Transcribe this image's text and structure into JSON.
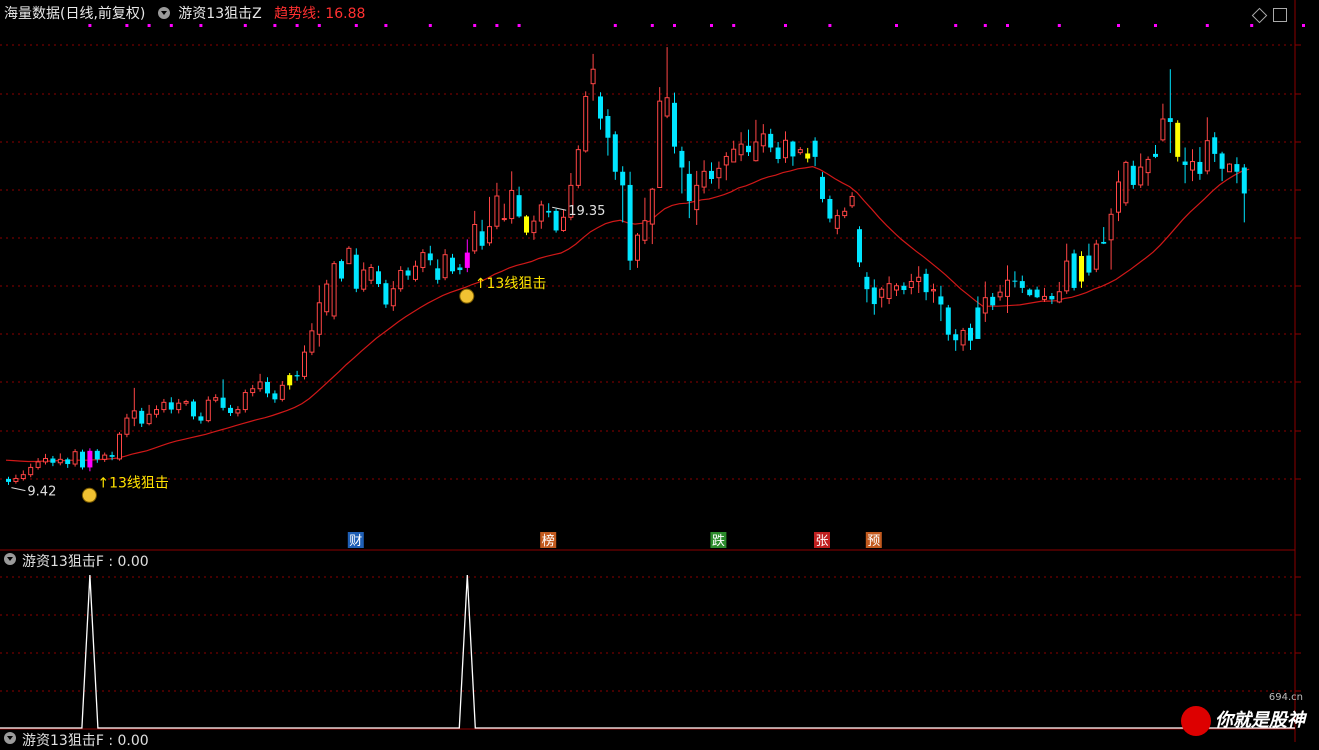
{
  "header": {
    "source": "海量数据(日线,前复权)",
    "indicator": "游资13狙击Z",
    "trend_label": "趋势线: 16.88"
  },
  "subpanel1": {
    "title": "游资13狙击F : 0.00"
  },
  "subpanel2": {
    "title": "游资13狙击F : 0.00"
  },
  "watermark": {
    "brand": "你就是股神",
    "url": "694.cn"
  },
  "colors": {
    "up": "#ff4545",
    "down": "#00e5ff",
    "signal_magenta": "#ff00ff",
    "signal_yellow": "#ffff00",
    "ma": "#d01818",
    "grid": "#8b0000",
    "label_yellow": "#ffe400",
    "spike": "#ffffff"
  },
  "chart_data": [
    {
      "type": "candlestick",
      "title": "游资13狙击Z",
      "candles": [
        [
          9.56,
          9.49,
          9.61,
          9.42
        ],
        [
          9.5,
          9.57,
          9.66,
          9.45
        ],
        [
          9.57,
          9.66,
          9.76,
          9.52
        ],
        [
          9.66,
          9.83,
          9.92,
          9.6
        ],
        [
          9.83,
          9.96,
          10.05,
          9.78
        ],
        [
          9.96,
          10.04,
          10.15,
          9.9
        ],
        [
          10.04,
          9.94,
          10.1,
          9.86
        ],
        [
          9.94,
          10.02,
          10.16,
          9.88
        ],
        [
          10.02,
          9.91,
          10.06,
          9.82
        ],
        [
          9.91,
          10.2,
          10.26,
          9.85
        ],
        [
          10.2,
          9.83,
          10.25,
          9.78
        ],
        [
          9.83,
          10.22,
          10.28,
          9.74
        ],
        [
          10.22,
          10.02,
          10.26,
          9.94
        ],
        [
          10.02,
          10.12,
          10.18,
          9.96
        ],
        [
          10.12,
          10.08,
          10.2,
          10.0
        ],
        [
          10.03,
          10.61,
          10.66,
          9.99
        ],
        [
          10.61,
          10.99,
          11.09,
          10.54
        ],
        [
          10.99,
          11.16,
          11.7,
          10.8
        ],
        [
          11.16,
          10.86,
          11.23,
          10.78
        ],
        [
          10.86,
          11.08,
          11.3,
          10.82
        ],
        [
          11.08,
          11.19,
          11.29,
          11.0
        ],
        [
          11.19,
          11.36,
          11.44,
          11.12
        ],
        [
          11.36,
          11.19,
          11.48,
          11.1
        ],
        [
          11.19,
          11.34,
          11.44,
          11.1
        ],
        [
          11.34,
          11.38,
          11.42,
          11.28
        ],
        [
          11.38,
          11.03,
          11.43,
          10.96
        ],
        [
          11.03,
          10.93,
          11.12,
          10.86
        ],
        [
          10.93,
          11.41,
          11.5,
          10.89
        ],
        [
          11.41,
          11.47,
          11.55,
          11.36
        ],
        [
          11.47,
          11.23,
          11.9,
          11.17
        ],
        [
          11.23,
          11.11,
          11.3,
          11.04
        ],
        [
          11.11,
          11.19,
          11.27,
          11.03
        ],
        [
          11.19,
          11.59,
          11.66,
          11.12
        ],
        [
          11.59,
          11.68,
          11.77,
          11.5
        ],
        [
          11.68,
          11.84,
          12.03,
          11.61
        ],
        [
          11.84,
          11.57,
          11.95,
          11.48
        ],
        [
          11.57,
          11.43,
          11.64,
          11.35
        ],
        [
          11.43,
          11.76,
          11.86,
          11.38
        ],
        [
          11.76,
          12.0,
          12.05,
          11.66
        ],
        [
          12.0,
          11.97,
          12.1,
          11.87
        ],
        [
          11.97,
          12.54,
          12.7,
          11.9
        ],
        [
          12.54,
          13.04,
          13.22,
          12.47
        ],
        [
          12.96,
          13.7,
          14.11,
          12.67
        ],
        [
          13.49,
          14.14,
          14.24,
          13.4
        ],
        [
          13.39,
          14.62,
          14.68,
          13.31
        ],
        [
          14.68,
          14.27,
          14.72,
          14.2
        ],
        [
          14.62,
          14.98,
          15.03,
          14.62
        ],
        [
          14.83,
          14.03,
          14.98,
          13.95
        ],
        [
          14.02,
          14.47,
          14.65,
          13.96
        ],
        [
          14.23,
          14.53,
          14.61,
          14.14
        ],
        [
          14.44,
          14.14,
          14.57,
          14.07
        ],
        [
          14.16,
          13.66,
          14.24,
          13.58
        ],
        [
          13.63,
          14.03,
          14.21,
          13.51
        ],
        [
          14.03,
          14.46,
          14.56,
          13.96
        ],
        [
          14.46,
          14.34,
          14.53,
          14.24
        ],
        [
          14.25,
          14.56,
          14.69,
          14.2
        ],
        [
          14.53,
          14.88,
          14.96,
          14.42
        ],
        [
          14.86,
          14.7,
          15.04,
          14.58
        ],
        [
          14.51,
          14.24,
          14.72,
          14.15
        ],
        [
          14.29,
          14.83,
          14.96,
          14.23
        ],
        [
          14.76,
          14.44,
          14.85,
          14.38
        ],
        [
          14.53,
          14.47,
          14.61,
          14.37
        ],
        [
          14.52,
          14.88,
          15.19,
          14.42
        ],
        [
          14.92,
          15.54,
          15.86,
          14.85
        ],
        [
          15.38,
          15.04,
          15.65,
          14.95
        ],
        [
          15.11,
          15.49,
          16.19,
          15.04
        ],
        [
          15.5,
          16.21,
          16.52,
          15.43
        ],
        [
          15.67,
          15.68,
          16.03,
          15.61
        ],
        [
          15.68,
          16.34,
          16.79,
          15.56
        ],
        [
          16.23,
          15.73,
          16.43,
          15.7
        ],
        [
          15.73,
          15.35,
          15.76,
          15.29
        ],
        [
          15.35,
          15.62,
          15.75,
          15.18
        ],
        [
          15.62,
          16.0,
          16.1,
          15.44
        ],
        [
          15.86,
          15.82,
          16.04,
          15.71
        ],
        [
          15.86,
          15.4,
          15.91,
          15.35
        ],
        [
          15.4,
          15.71,
          15.88,
          15.37
        ],
        [
          15.71,
          16.46,
          16.75,
          15.64
        ],
        [
          16.46,
          17.3,
          17.4,
          16.39
        ],
        [
          17.27,
          18.55,
          18.67,
          17.23
        ],
        [
          18.85,
          19.19,
          19.55,
          18.45
        ],
        [
          18.55,
          18.03,
          18.65,
          17.77
        ],
        [
          18.09,
          17.58,
          18.25,
          17.16
        ],
        [
          17.66,
          16.78,
          17.73,
          16.59
        ],
        [
          16.78,
          16.46,
          16.91,
          15.59
        ],
        [
          16.47,
          14.69,
          16.78,
          14.47
        ],
        [
          14.7,
          15.29,
          15.34,
          14.52
        ],
        [
          15.17,
          15.63,
          16.17,
          15.08
        ],
        [
          15.55,
          16.37,
          16.4,
          15.08
        ],
        [
          16.41,
          18.44,
          18.77,
          16.44
        ],
        [
          18.09,
          18.52,
          19.71,
          18.04
        ],
        [
          18.4,
          17.37,
          18.64,
          17.21
        ],
        [
          17.27,
          16.88,
          17.37,
          16.27
        ],
        [
          16.73,
          16.09,
          17.03,
          15.69
        ],
        [
          15.89,
          16.46,
          16.8,
          15.53
        ],
        [
          16.42,
          16.79,
          17.05,
          16.27
        ],
        [
          16.8,
          16.61,
          17.0,
          16.5
        ],
        [
          16.64,
          16.86,
          17.02,
          16.38
        ],
        [
          16.94,
          17.14,
          17.24,
          16.58
        ],
        [
          17.01,
          17.31,
          17.51,
          17.15
        ],
        [
          17.18,
          17.43,
          17.71,
          17.03
        ],
        [
          17.39,
          17.24,
          17.77,
          17.15
        ],
        [
          17.04,
          17.48,
          18.0,
          17.02
        ],
        [
          17.39,
          17.67,
          17.9,
          17.23
        ],
        [
          17.67,
          17.35,
          17.79,
          17.24
        ],
        [
          17.35,
          17.08,
          17.48,
          16.98
        ],
        [
          17.11,
          17.52,
          17.73,
          16.99
        ],
        [
          17.49,
          17.14,
          17.51,
          16.92
        ],
        [
          17.23,
          17.3,
          17.36,
          17.18
        ],
        [
          17.21,
          17.09,
          17.34,
          17.0
        ],
        [
          17.51,
          17.13,
          17.59,
          16.91
        ],
        [
          16.66,
          16.14,
          16.77,
          16.06
        ],
        [
          16.14,
          15.68,
          16.22,
          15.59
        ],
        [
          15.45,
          15.75,
          15.89,
          15.31
        ],
        [
          15.75,
          15.85,
          15.94,
          15.69
        ],
        [
          15.98,
          16.2,
          16.3,
          15.93
        ],
        [
          15.43,
          14.65,
          15.5,
          14.54
        ],
        [
          14.31,
          14.02,
          14.42,
          13.71
        ],
        [
          14.06,
          13.67,
          14.25,
          13.42
        ],
        [
          13.83,
          14.02,
          14.07,
          13.59
        ],
        [
          13.8,
          14.15,
          14.32,
          13.67
        ],
        [
          14.0,
          14.1,
          14.16,
          13.86
        ],
        [
          14.1,
          14.0,
          14.18,
          13.9
        ],
        [
          14.06,
          14.2,
          14.38,
          13.9
        ],
        [
          14.2,
          14.3,
          14.56,
          13.93
        ],
        [
          14.38,
          13.95,
          14.5,
          13.76
        ],
        [
          13.98,
          14.01,
          14.15,
          13.7
        ],
        [
          13.85,
          13.66,
          14.1,
          13.27
        ],
        [
          13.59,
          12.95,
          13.65,
          12.81
        ],
        [
          12.96,
          12.82,
          13.08,
          12.57
        ],
        [
          12.71,
          13.05,
          13.11,
          12.57
        ],
        [
          13.11,
          12.81,
          13.21,
          12.59
        ],
        [
          13.59,
          12.85,
          13.85,
          12.85
        ],
        [
          13.46,
          13.82,
          14.2,
          13.25
        ],
        [
          13.84,
          13.64,
          13.93,
          13.53
        ],
        [
          13.84,
          13.95,
          14.12,
          13.75
        ],
        [
          13.85,
          14.23,
          14.58,
          13.46
        ],
        [
          14.22,
          14.21,
          14.44,
          14.06
        ],
        [
          14.21,
          14.05,
          14.34,
          13.93
        ],
        [
          14.01,
          13.88,
          14.04,
          13.85
        ],
        [
          14.01,
          13.83,
          14.08,
          13.81
        ],
        [
          13.78,
          13.85,
          14.05,
          13.72
        ],
        [
          13.86,
          13.78,
          13.93,
          13.67
        ],
        [
          13.72,
          13.96,
          14.19,
          13.69
        ],
        [
          13.98,
          14.68,
          15.09,
          13.91
        ],
        [
          14.86,
          14.05,
          14.95,
          13.99
        ],
        [
          14.2,
          14.8,
          14.91,
          14.05
        ],
        [
          14.81,
          14.41,
          15.09,
          14.34
        ],
        [
          14.49,
          15.08,
          15.18,
          14.42
        ],
        [
          15.13,
          15.09,
          15.48,
          15.08
        ],
        [
          15.18,
          15.78,
          15.92,
          14.48
        ],
        [
          15.83,
          16.54,
          16.81,
          15.62
        ],
        [
          16.05,
          17.0,
          17.04,
          15.98
        ],
        [
          16.92,
          16.47,
          17.04,
          16.38
        ],
        [
          16.47,
          16.89,
          17.21,
          16.4
        ],
        [
          16.76,
          17.07,
          17.14,
          16.45
        ],
        [
          17.2,
          17.13,
          17.41,
          17.1
        ],
        [
          17.53,
          18.02,
          18.38,
          17.49
        ],
        [
          18.04,
          17.95,
          19.19,
          17.22
        ],
        [
          17.93,
          17.13,
          17.99,
          17.02
        ],
        [
          17.02,
          16.94,
          17.35,
          16.51
        ],
        [
          16.82,
          17.02,
          17.31,
          16.56
        ],
        [
          17.01,
          16.73,
          17.36,
          16.59
        ],
        [
          16.8,
          17.51,
          18.06,
          16.72
        ],
        [
          17.59,
          17.2,
          17.71,
          17.01
        ],
        [
          17.21,
          16.85,
          17.25,
          16.56
        ],
        [
          16.78,
          16.96,
          16.98,
          16.85
        ],
        [
          16.96,
          16.78,
          17.12,
          16.51
        ],
        [
          16.88,
          16.27,
          16.96,
          15.59
        ]
      ],
      "ma_values": [
        10.0,
        9.99,
        9.98,
        9.97,
        9.97,
        9.98,
        9.98,
        9.99,
        9.99,
        10.0,
        10.0,
        10.0,
        10.01,
        10.02,
        10.03,
        10.05,
        10.09,
        10.14,
        10.18,
        10.22,
        10.28,
        10.34,
        10.4,
        10.45,
        10.49,
        10.53,
        10.57,
        10.61,
        10.66,
        10.71,
        10.76,
        10.81,
        10.86,
        10.91,
        10.96,
        11.0,
        11.05,
        11.11,
        11.17,
        11.24,
        11.33,
        11.45,
        11.6,
        11.76,
        11.92,
        12.08,
        12.25,
        12.4,
        12.56,
        12.71,
        12.86,
        12.99,
        13.12,
        13.25,
        13.37,
        13.48,
        13.59,
        13.69,
        13.78,
        13.87,
        13.94,
        14.0,
        14.06,
        14.13,
        14.19,
        14.27,
        14.37,
        14.44,
        14.52,
        14.58,
        14.62,
        14.67,
        14.74,
        14.79,
        14.83,
        14.87,
        14.96,
        15.08,
        15.23,
        15.37,
        15.47,
        15.56,
        15.61,
        15.64,
        15.58,
        15.55,
        15.57,
        15.62,
        15.77,
        15.91,
        15.99,
        16.03,
        16.04,
        16.08,
        16.12,
        16.14,
        16.19,
        16.24,
        16.31,
        16.4,
        16.45,
        16.52,
        16.6,
        16.66,
        16.7,
        16.76,
        16.8,
        16.85,
        16.87,
        16.9,
        16.83,
        16.73,
        16.62,
        16.52,
        16.43,
        16.29,
        16.09,
        15.9,
        15.7,
        15.52,
        15.35,
        15.19,
        15.05,
        14.91,
        14.78,
        14.64,
        14.5,
        14.35,
        14.19,
        14.03,
        13.89,
        13.75,
        13.62,
        13.62,
        13.62,
        13.63,
        13.64,
        13.65,
        13.68,
        13.71,
        13.74,
        13.74,
        13.75,
        13.8,
        13.83,
        13.88,
        13.94,
        14.02,
        14.08,
        14.16,
        14.25,
        14.37,
        14.49,
        14.62,
        14.75,
        14.89,
        15.06,
        15.25,
        15.45,
        15.65,
        15.83,
        15.99,
        16.15,
        16.32,
        16.47,
        16.59,
        16.7,
        16.79,
        16.84
      ],
      "signals_magenta": [
        11,
        62
      ],
      "signals_yellow": [
        38,
        70,
        108,
        145,
        158
      ],
      "markers_top": [
        11,
        16,
        19,
        22,
        26,
        32,
        36,
        39,
        42,
        47,
        51,
        57,
        63,
        66,
        69,
        82,
        87,
        90,
        95,
        98,
        105,
        111,
        120,
        128,
        132,
        135,
        142,
        150,
        155,
        162,
        168,
        175
      ],
      "annotations": [
        {
          "idx": 1,
          "text": "9.42"
        },
        {
          "idx": 73,
          "text": "19.35"
        }
      ],
      "signal_labels": [
        {
          "idx": 11,
          "text": "13线狙击"
        },
        {
          "idx": 62,
          "text": "13线狙击"
        }
      ],
      "event_tags": [
        {
          "idx": 47,
          "text": "财",
          "color": "#1f5fb5"
        },
        {
          "idx": 73,
          "text": "榜",
          "color": "#c25a1e"
        },
        {
          "idx": 96,
          "text": "跌",
          "color": "#2c8c2c"
        },
        {
          "idx": 110,
          "text": "张",
          "color": "#c02020"
        },
        {
          "idx": 117,
          "text": "预",
          "color": "#c25a1e"
        }
      ],
      "ylim": [
        8.9,
        20.3
      ]
    },
    {
      "type": "line",
      "title": "游资13狙击F",
      "spikes": [
        11,
        62
      ],
      "ylim": [
        0,
        1
      ]
    }
  ]
}
